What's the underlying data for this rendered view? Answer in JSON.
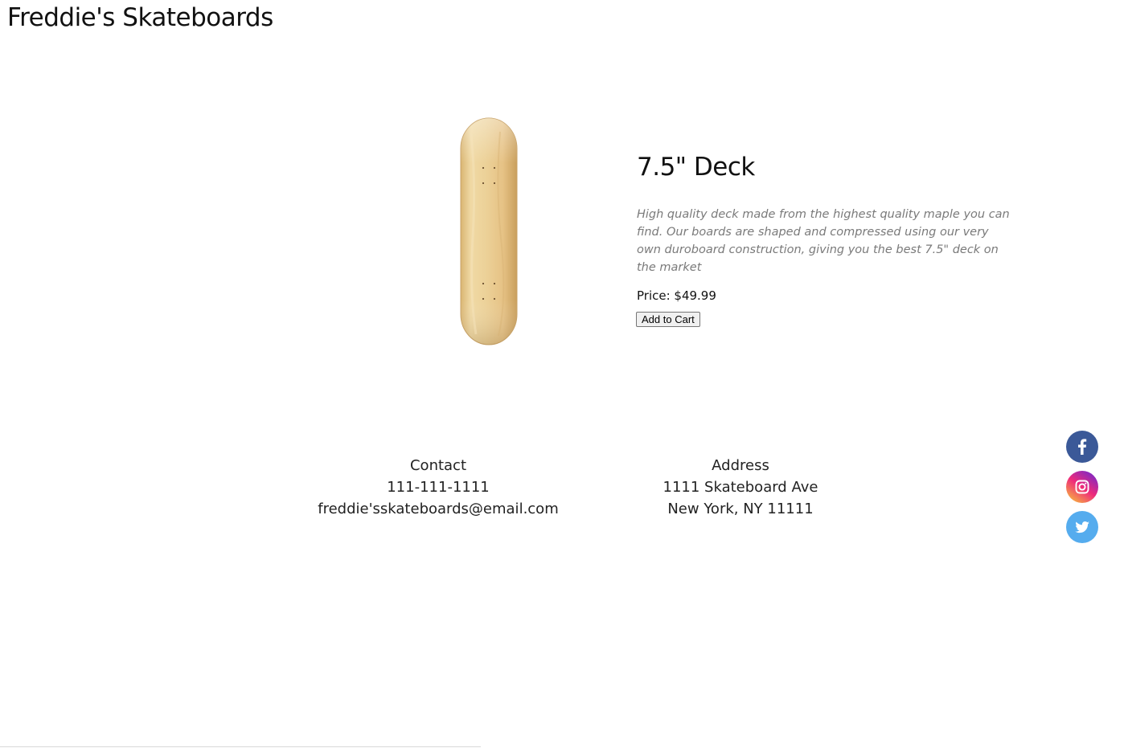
{
  "header": {
    "site_title": "Freddie's Skateboards"
  },
  "product": {
    "name": "7.5\" Deck",
    "description": "High quality deck made from the highest quality maple you can find. Our boards are shaped and compressed using our very own duroboard construction, giving you the best 7.5\" deck on the market",
    "price_label": "Price: $49.99",
    "add_to_cart_label": "Add to Cart",
    "image_icon": "skateboard-deck-icon"
  },
  "footer": {
    "contact": {
      "heading": "Contact",
      "phone": "111-111-1111",
      "email": "freddie'sskateboards@email.com"
    },
    "address": {
      "heading": "Address",
      "line1": "1111 Skateboard Ave",
      "line2": "New York, NY 11111"
    }
  },
  "social": {
    "items": [
      {
        "name": "facebook",
        "icon": "facebook-icon",
        "color": "#3b5998"
      },
      {
        "name": "instagram",
        "icon": "instagram-icon",
        "color": "#e1306c"
      },
      {
        "name": "twitter",
        "icon": "twitter-icon",
        "color": "#55acee"
      }
    ]
  },
  "colors": {
    "deck_wood": "#e8c98a",
    "description_text": "#7a7a7a"
  }
}
